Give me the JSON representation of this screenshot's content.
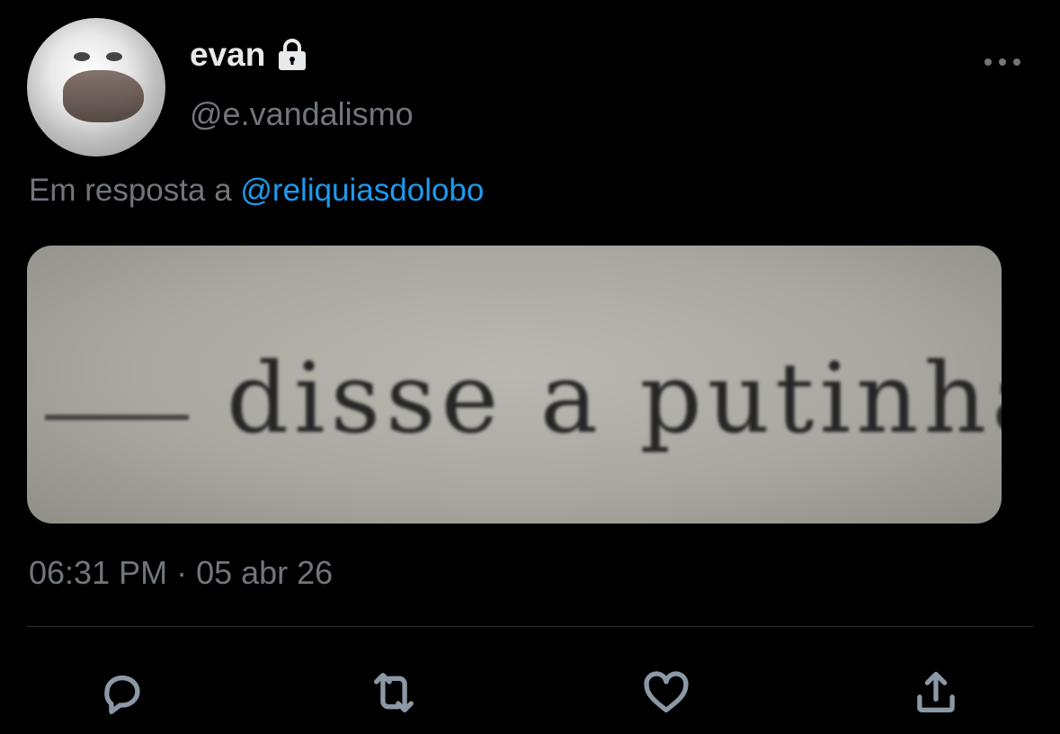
{
  "tweet": {
    "author": {
      "name": "evan",
      "handle": "@e.vandalismo",
      "locked": true
    },
    "reply_to": {
      "prefix": "Em resposta a",
      "mention": "@reliquiasdolobo"
    },
    "media": {
      "text": "disse a putinha."
    },
    "timestamp": "06:31 PM · 05 abr 26"
  },
  "icons": {
    "lock": "lock-icon",
    "more": "more-icon",
    "reply": "reply-icon",
    "retweet": "retweet-icon",
    "like": "heart-icon",
    "share": "share-icon"
  },
  "colors": {
    "background": "#000000",
    "primary_text": "#e7e9ea",
    "secondary_text": "#71767b",
    "link": "#1d9bf0",
    "icon": "#8b98a5",
    "divider": "#2f3336"
  }
}
